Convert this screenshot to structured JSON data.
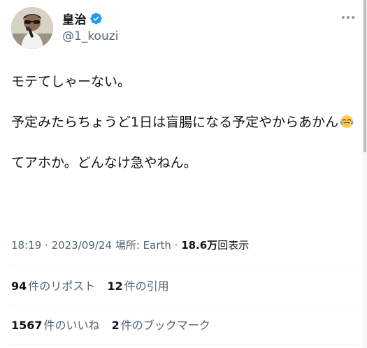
{
  "user": {
    "display_name": "皇治",
    "handle": "@1_kouzi",
    "verified": true,
    "avatar_icon": "profile-photo"
  },
  "tweet": {
    "paragraphs": [
      "モテてしゃーない。",
      "予定みたらちょうど1日は盲腸になる予定やからあかん",
      "てアホか。どんなけ急やねん。"
    ],
    "emoji": "face-with-tears-of-joy"
  },
  "meta": {
    "time": "18:19",
    "separator": "·",
    "date": "2023/09/24",
    "location": "場所: Earth",
    "views_count": "18.6万",
    "views_label": "回表示"
  },
  "stats": {
    "reposts_count": "94",
    "reposts_label": "件のリポスト",
    "quotes_count": "12",
    "quotes_label": "件の引用",
    "likes_count": "1567",
    "likes_label": "件のいいね",
    "bookmarks_count": "2",
    "bookmarks_label": "件のブックマーク"
  },
  "colors": {
    "text_primary": "#0f1419",
    "text_secondary": "#536471",
    "verified_blue": "#1d9bf0",
    "divider": "#eff3f4"
  }
}
